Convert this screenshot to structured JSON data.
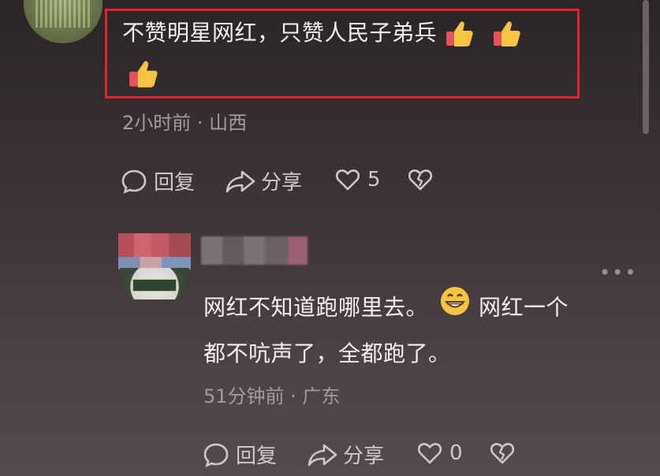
{
  "comment1": {
    "text_line1": "不赞明星网红，只赞人民子弟兵",
    "meta": "2小时前 · 山西",
    "actions": {
      "reply_label": "回复",
      "share_label": "分享",
      "like_count": "5"
    }
  },
  "comment2": {
    "text_line1_a": "网红不知道跑哪里去。",
    "text_line1_b": "网红一个",
    "text_line2": "都不吭声了，全都跑了。",
    "meta": "51分钟前 · 广东",
    "actions": {
      "reply_label": "回复",
      "share_label": "分享",
      "like_count": "0"
    },
    "more_label": "•••"
  },
  "colors": {
    "highlight_border": "#e5232f",
    "thumb_yellow": "#f6c343",
    "thumb_red": "#e9515c"
  }
}
